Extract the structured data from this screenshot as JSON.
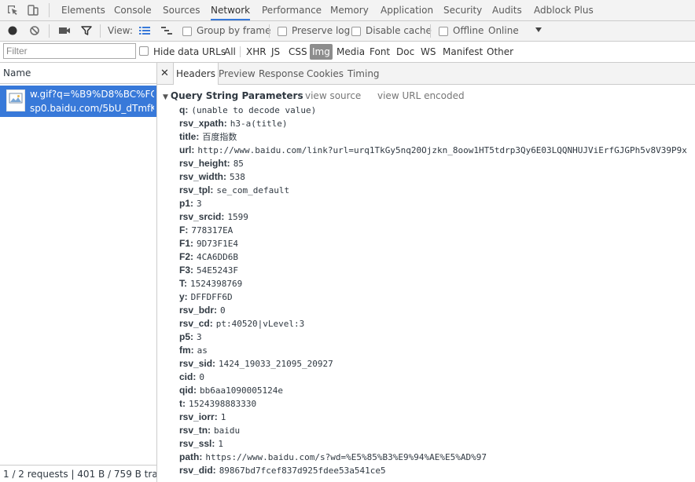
{
  "tabs": [
    "Elements",
    "Console",
    "Sources",
    "Network",
    "Performance",
    "Memory",
    "Application",
    "Security",
    "Audits",
    "Adblock Plus"
  ],
  "active_tab": "Network",
  "toolbar": {
    "view_label": "View:",
    "group_by_frame": "Group by frame",
    "preserve_log": "Preserve log",
    "disable_cache": "Disable cache",
    "offline": "Offline",
    "throttling": "Online"
  },
  "filter": {
    "placeholder": "Filter",
    "hide_data_urls": "Hide data URLs",
    "types": [
      "All",
      "XHR",
      "JS",
      "CSS",
      "Img",
      "Media",
      "Font",
      "Doc",
      "WS",
      "Manifest",
      "Other"
    ],
    "active_type": "Img"
  },
  "request_list": {
    "header": "Name",
    "items": [
      {
        "name": "w.gif?q=%B9%D8%BC%FC...",
        "domain": "sp0.baidu.com/5bU_dTmfK..."
      }
    ],
    "status": "1 / 2 requests | 401 B / 759 B tran..."
  },
  "detail_tabs": [
    "Headers",
    "Preview",
    "Response",
    "Cookies",
    "Timing"
  ],
  "active_detail_tab": "Headers",
  "query_section": {
    "title": "Query String Parameters",
    "view_source": "view source",
    "view_url_encoded": "view URL encoded",
    "params": [
      {
        "key": "q:",
        "value": "(unable to decode value)"
      },
      {
        "key": "rsv_xpath:",
        "value": "h3-a(title)"
      },
      {
        "key": "title:",
        "value": "百度指数"
      },
      {
        "key": "url:",
        "value": "http://www.baidu.com/link?url=urq1TkGy5nq20Ojzkn_8oow1HT5tdrp3Qy6E03LQQNHUJViErfGJGPh5v8V39P9x"
      },
      {
        "key": "rsv_height:",
        "value": "85"
      },
      {
        "key": "rsv_width:",
        "value": "538"
      },
      {
        "key": "rsv_tpl:",
        "value": "se_com_default"
      },
      {
        "key": "p1:",
        "value": "3"
      },
      {
        "key": "rsv_srcid:",
        "value": "1599"
      },
      {
        "key": "F:",
        "value": "778317EA"
      },
      {
        "key": "F1:",
        "value": "9D73F1E4"
      },
      {
        "key": "F2:",
        "value": "4CA6DD6B"
      },
      {
        "key": "F3:",
        "value": "54E5243F"
      },
      {
        "key": "T:",
        "value": "1524398769"
      },
      {
        "key": "y:",
        "value": "DFFDFF6D"
      },
      {
        "key": "rsv_bdr:",
        "value": "0"
      },
      {
        "key": "rsv_cd:",
        "value": "pt:40520|vLevel:3"
      },
      {
        "key": "p5:",
        "value": "3"
      },
      {
        "key": "fm:",
        "value": "as"
      },
      {
        "key": "rsv_sid:",
        "value": "1424_19033_21095_20927"
      },
      {
        "key": "cid:",
        "value": "0"
      },
      {
        "key": "qid:",
        "value": "bb6aa1090005124e"
      },
      {
        "key": "t:",
        "value": "1524398883330"
      },
      {
        "key": "rsv_iorr:",
        "value": "1"
      },
      {
        "key": "rsv_tn:",
        "value": "baidu"
      },
      {
        "key": "rsv_ssl:",
        "value": "1"
      },
      {
        "key": "path:",
        "value": "https://www.baidu.com/s?wd=%E5%85%B3%E9%94%AE%E5%AD%97"
      },
      {
        "key": "rsv_did:",
        "value": "89867bd7fcef837d925fdee53a541ce5"
      }
    ]
  },
  "colors": {
    "accent": "#3879d9",
    "selected_row": "#3879d9",
    "active_filter_bg": "#8d8d8d"
  }
}
